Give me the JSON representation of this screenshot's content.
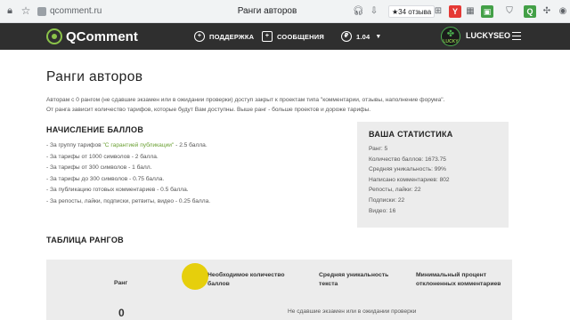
{
  "browser": {
    "url": "qcomment.ru",
    "tab_title": "Ранги авторов",
    "rating": "34 отзыва",
    "rating_star": "★",
    "lock_icon": "lock-icon",
    "star_icon": "star-icon"
  },
  "site": {
    "logo": "QComment",
    "nav": {
      "support": "ПОДДЕРЖКА",
      "messages": "СООБЩЕНИЯ",
      "balance": "1.04"
    },
    "user": {
      "avatar_text": "LUCKY",
      "name": "LUCKYSEO"
    }
  },
  "page": {
    "title": "Ранги авторов",
    "intro_line1": "Авторам с 0 рангом (не сдавшие экзамен или в ожидании проверки) доступ закрыт к проектам типа \"комментарии, отзывы, наполнение форума\".",
    "intro_line2": "От ранга зависит количество тарифов, которые будут Вам доступны. Выше ранг - больше проектов и дороже тарифы."
  },
  "scoring": {
    "title": "НАЧИСЛЕНИЕ БАЛЛОВ",
    "line0_prefix": "- За группу тарифов ",
    "line0_highlight": "\"С гарантией публикации\"",
    "line0_suffix": " - 2.5 балла.",
    "lines": [
      "- За тарифы от 1000 символов - 2 балла.",
      "- За тарифы от 300 символов - 1 балл.",
      "- За тарифы до 300 символов - 0.75 балла.",
      "- За публикацию готовых комментариев - 0.5 балла.",
      "- За репосты, лайки, подписки, ретвиты, видео - 0.25 балла."
    ]
  },
  "stats": {
    "title": "ВАША СТАТИСТИКА",
    "lines": [
      "Ранг: 5",
      "Количество баллов: 1673.75",
      "Средняя уникальность: 99%",
      "Написано комментариев: 802",
      "Репосты, лайки: 22",
      "Подписки: 22",
      "Видео: 16"
    ]
  },
  "rank_table": {
    "title": "ТАБЛИЦА РАНГОВ",
    "headers": {
      "rank": "Ранг",
      "points_line1": "Необходимое количество",
      "points_line2": "баллов",
      "uniq_line1": "Средняя уникальность",
      "uniq_line2": "текста",
      "rejected_line1": "Минимальный процент",
      "rejected_line2": "отклоненных комментариев"
    },
    "rows": [
      {
        "rank": "0",
        "note": "Не сдавшие экзамен или в ожидании проверки"
      }
    ]
  },
  "colors": {
    "header_bg": "#2f2f2f",
    "accent_green": "#6aa032",
    "panel_bg": "#ececec",
    "cursor_highlight": "#e6cd00"
  }
}
